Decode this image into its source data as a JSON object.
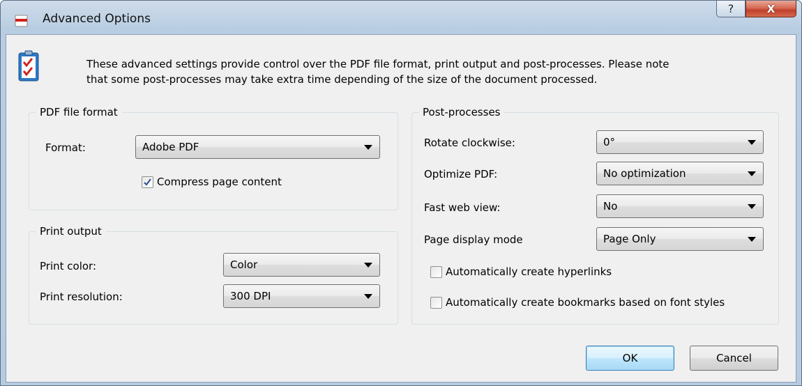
{
  "window": {
    "title": "Advanced Options",
    "help_glyph": "?",
    "close_glyph": "X"
  },
  "description": {
    "line1": "These advanced settings provide control over the PDF file format, print output and post-processes. Please note",
    "line2": "that some post-processes may take extra time depending of the size of the document processed."
  },
  "pdf_format": {
    "legend": "PDF file format",
    "format_label": "Format:",
    "format_value": "Adobe PDF",
    "compress_label": "Compress page content",
    "compress_checked": true
  },
  "print_output": {
    "legend": "Print output",
    "color_label": "Print color:",
    "color_value": "Color",
    "resolution_label": "Print resolution:",
    "resolution_value": "300 DPI"
  },
  "post_processes": {
    "legend": "Post-processes",
    "rotate_label": "Rotate clockwise:",
    "rotate_value": "0°",
    "optimize_label": "Optimize PDF:",
    "optimize_value": "No optimization",
    "fastweb_label": "Fast web view:",
    "fastweb_value": "No",
    "display_label": "Page display mode",
    "display_value": "Page Only",
    "hyperlinks_label": "Automatically create hyperlinks",
    "hyperlinks_checked": false,
    "bookmarks_label": "Automatically create bookmarks based on font styles",
    "bookmarks_checked": false
  },
  "buttons": {
    "ok": "OK",
    "cancel": "Cancel"
  },
  "colors": {
    "title_bar": "#b9cde2",
    "dialog_bg": "#f0f0f0",
    "close_button": "#c1412b",
    "default_button_border": "#3c7fb1"
  },
  "icons": {
    "title": "pdf-document-icon",
    "description": "checklist-icon"
  }
}
